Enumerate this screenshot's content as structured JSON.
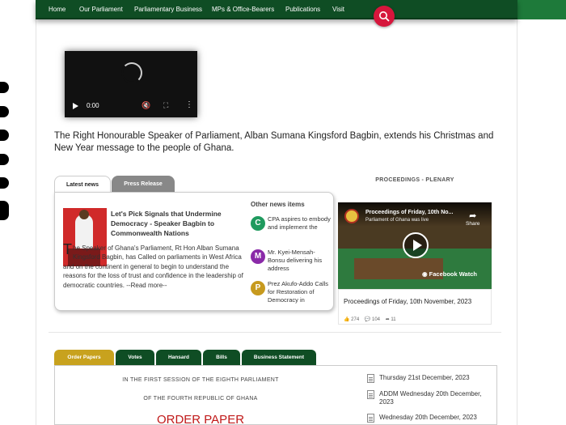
{
  "nav": {
    "items": [
      "Home",
      "Our Parliament",
      "Parliamentary Business",
      "MPs & Office-Bearers",
      "Publications",
      "Visit"
    ]
  },
  "video": {
    "time": "0:00"
  },
  "caption": "The Right Honourable Speaker of Parliament, Alban Sumana Kingsford Bagbin, extends his Christmas and New Year message to the people of Ghana.",
  "news": {
    "tabs": [
      "Latest news",
      "Press Release"
    ],
    "title": "Let's Pick Signals that Undermine Democracy - Speaker Bagbin to Commonwealth Nations",
    "dropcap": "T",
    "body": "he Speaker of Ghana's Parliament, Rt Hon Alban Sumana Kingsford Bagbin, has Called on parliaments in West Africa and on the continent in general to begin to understand the reasons for the loss of trust and confidence in the leadership of democratic countries.",
    "read_more": "--Read more--",
    "other_title": "Other news items",
    "other": [
      {
        "letter": "C",
        "color": "#1f9a5e",
        "text": "CPA aspires to embody and implement the"
      },
      {
        "letter": "M",
        "color": "#8a2aa8",
        "text": "Mr. Kyei-Mensah-Bonsu delivering his address"
      },
      {
        "letter": "P",
        "color": "#c79a1e",
        "text": "Prez Akufo-Addo Calls for Restoration of Democracy in"
      }
    ]
  },
  "proceedings": {
    "heading": "PROCEEDINGS - PLENARY",
    "video_title": "Proceedings of Friday, 10th No...",
    "video_sub": "Parliament of Ghana was live",
    "share": "Share",
    "fb": "Facebook Watch",
    "caption": "Proceedings of Friday, 10th November, 2023",
    "likes": "274",
    "comments": "104",
    "shares": "11"
  },
  "bottom": {
    "tabs": [
      "Order Papers",
      "Votes",
      "Hansard",
      "Bills",
      "Business Statement"
    ],
    "line1": "IN THE FIRST SESSION OF THE EIGHTH PARLIAMENT",
    "line2": "OF THE FOURTH REPUBLIC OF GHANA",
    "line3": "ORDER PAPER",
    "docs": [
      "Thursday 21st December, 2023",
      "ADDM Wednesday 20th December, 2023",
      "Wednesday 20th December, 2023"
    ]
  },
  "colors": {
    "nav_green": "#0f4d24",
    "accent_red": "#d6163c",
    "tab_gold": "#c8a21e"
  },
  "icons": {
    "search": "search-icon",
    "play": "play-icon",
    "document": "document-icon"
  }
}
